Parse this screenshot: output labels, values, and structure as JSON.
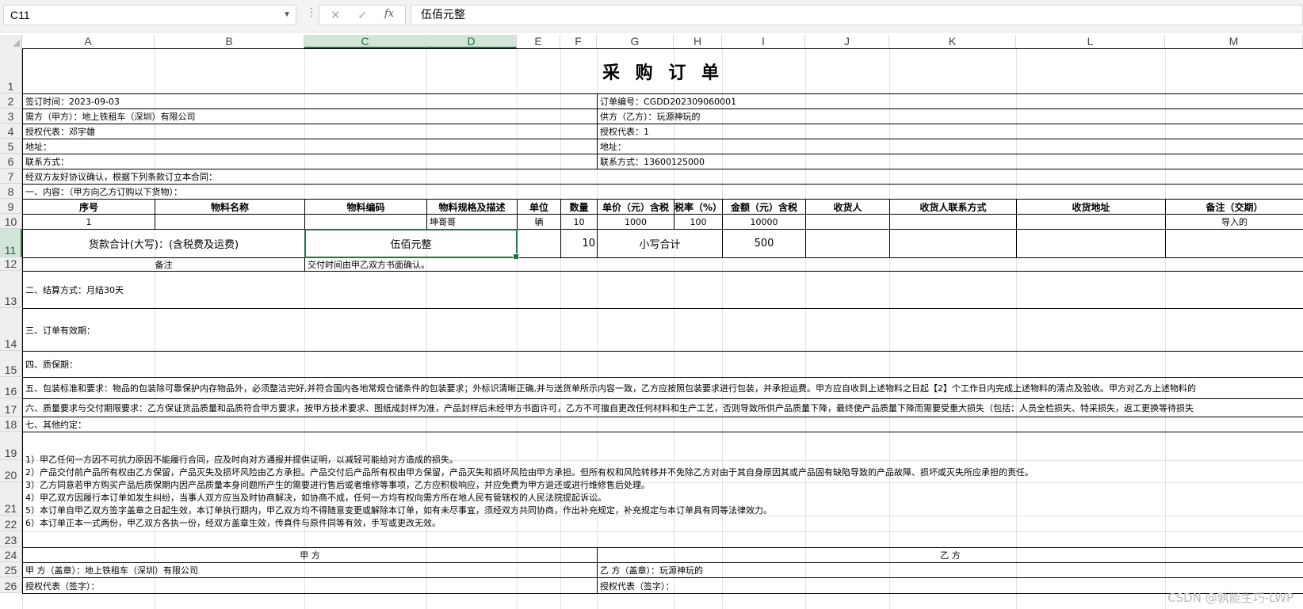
{
  "formula_bar": {
    "name_box": "C11",
    "dots": "⋮",
    "cancel_icon": "✕",
    "enter_icon": "✓",
    "fx_icon": "fx",
    "formula": "伍佰元整"
  },
  "columns": [
    "A",
    "B",
    "C",
    "D",
    "E",
    "F",
    "G",
    "H",
    "I",
    "J",
    "K",
    "L",
    "M"
  ],
  "rows": [
    "1",
    "2",
    "3",
    "4",
    "5",
    "6",
    "7",
    "8",
    "9",
    "10",
    "11",
    "12",
    "13",
    "14",
    "15",
    "16",
    "17",
    "18",
    "19",
    "20",
    "21",
    "22",
    "23",
    "24",
    "25",
    "26"
  ],
  "sheet": {
    "title": "采 购 订 单",
    "sign_date": "签订时间：2023-09-03",
    "order_no": "订单编号：CGDD202309060001",
    "party_a": "需方（甲方）：地上铁租车（深圳）有限公司",
    "party_b": "供方（乙方）：玩源神玩的",
    "rep_a": "授权代表：邓宇雄",
    "rep_b": "授权代表：1",
    "addr_a": "地址：",
    "addr_b": "地址：",
    "contact_a": "联系方式：",
    "contact_b": "联系方式：13600125000",
    "intro": "经双方友好协议确认，根据下列条款订立本合同：",
    "section1": "一、内容：（甲方向乙方订购以下货物）：",
    "headers": [
      "序号",
      "物料名称",
      "物料编码",
      "物料规格及描述",
      "单位",
      "数量",
      "单价（元）含税",
      "税率（%）",
      "金额（元）含税",
      "收货人",
      "收货人联系方式",
      "收货地址",
      "备注（交期）"
    ],
    "row10": {
      "seq": "1",
      "spec": "坤哥哥",
      "unit": "辆",
      "qty": "10",
      "price": "1000",
      "tax": "100",
      "amount": "10000",
      "remark": "导入的"
    },
    "total_label": "货款合计(大写)：(含税费及运费)",
    "total_upper": "伍佰元整",
    "total_qty": "10",
    "small_total_label": "小写合计",
    "small_total": "500",
    "remark_label": "备注",
    "remark_text": "交付时间由甲乙双方书面确认。",
    "section2": "二、结算方式：月结30天",
    "section3": "三、订单有效期：",
    "section4": "四、质保期：",
    "section5": "五、包装标准和要求：物品的包装除可靠保护内存物品外，必须整洁完好,并符合国内各地常规仓储条件的包装要求；外标识清晰正确,并与送货单所示内容一致，乙方应按照包装要求进行包装，并承担运费。甲方应自收到上述物料之日起【2】个工作日内完成上述物料的清点及验收。甲方对乙方上述物料的",
    "section6": "六、质量要求与交付期限要求：乙方保证货品质量和品质符合甲方要求，按甲方技术要求、图纸成封样为准，产品封样后未经甲方书面许可，乙方不可擅自更改任何材料和生产工艺，否则导致所供产品质量下降，最终使产品质量下降而需要受重大损失（包括：人员全检损失、特采损失，返工更换等待损失",
    "section7": "七、其他约定：",
    "clauses": [
      "1）甲乙任何一方因不可抗力原因不能履行合同，应及时向对方通报并提供证明，以减轻可能给对方造成的损失。",
      "2）产品交付前产品所有权由乙方保留，产品灭失及损坏风险由乙方承担。产品交付后产品所有权由甲方保留，产品灭失和损坏风险由甲方承担。但所有权和风险转移并不免除乙方对由于其自身原因其或产品固有缺陷导致的产品故障、损坏或灭失所应承担的责任。",
      "3）乙方同意若甲方购买产品后质保期内因产品质量本身问题所产生的需要进行售后或者维修等事项，乙方应积极响应，并应免费为甲方退还或进行维修售后处理。",
      "4）甲乙双方因履行本订单如发生纠纷，当事人双方应当及时协商解决，如协商不成，任何一方均有权向需方所在地人民有管辖权的人民法院提起诉讼。",
      "5）本订单自甲乙双方签字盖章之日起生效，本订单执行期内，甲乙双方均不得随意变更或解除本订单，如有未尽事宜，须经双方共同协商，作出补充规定，补充规定与本订单具有同等法律效力。",
      "6）本订单正本一式两份，甲乙双方各执一份，经双方盖章生效，传真件与原件同等有效，手写或更改无效。"
    ],
    "sig_a_header": "甲 方",
    "sig_b_header": "乙 方",
    "seal_a": "甲 方（盖章）：地上铁租车（深圳）有限公司",
    "seal_b": "乙 方（盖章）：玩源神玩的",
    "sign_a": "授权代表（签字）：",
    "sign_b": "授权代表（签字）："
  },
  "watermark": "CSDN @孰能生巧-LWP"
}
